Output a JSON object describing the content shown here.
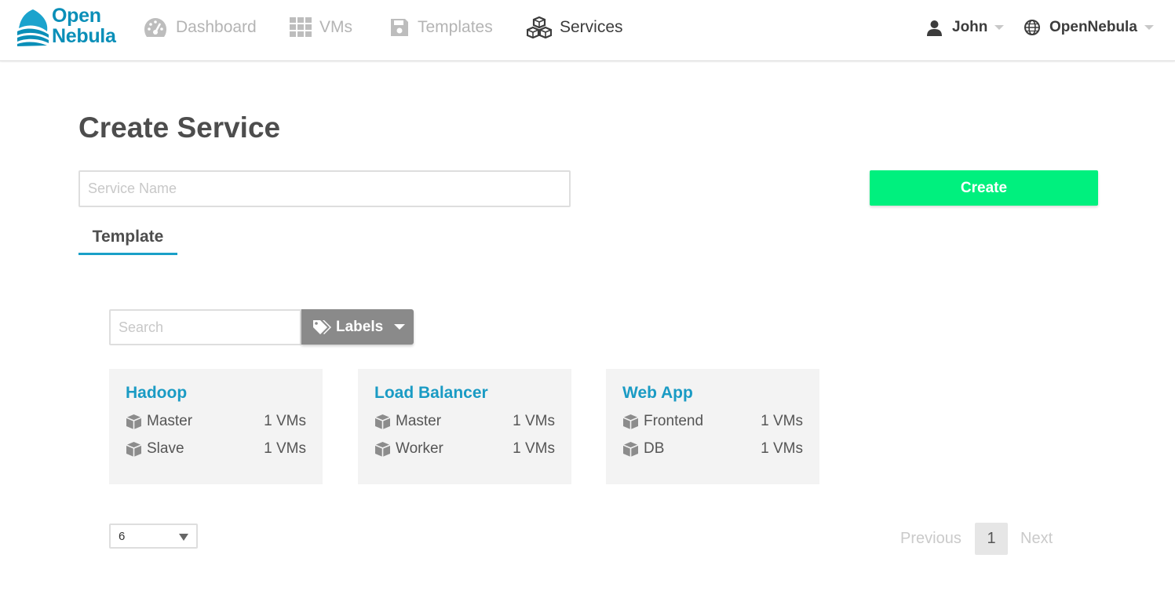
{
  "brand": {
    "line1": "Open",
    "line2": "Nebula",
    "color": "#0a8fb8"
  },
  "nav": [
    {
      "label": "Dashboard",
      "icon": "dashboard-icon",
      "active": false
    },
    {
      "label": "VMs",
      "icon": "grid-icon",
      "active": false
    },
    {
      "label": "Templates",
      "icon": "floppy-disk-icon",
      "active": false
    },
    {
      "label": "Services",
      "icon": "cubes-icon",
      "active": true
    }
  ],
  "user_menu": {
    "label": "John",
    "icon": "user-icon"
  },
  "zone_menu": {
    "label": "OpenNebula",
    "icon": "globe-icon"
  },
  "page": {
    "title": "Create Service",
    "service_name_placeholder": "Service Name",
    "service_name_value": "",
    "create_label": "Create",
    "create_color": "#00f07e",
    "tab_label": "Template"
  },
  "filter": {
    "search_placeholder": "Search",
    "labels_label": "Labels",
    "labels_icon": "tags-icon"
  },
  "templates": [
    {
      "name": "Hadoop",
      "roles": [
        {
          "name": "Master",
          "count": "1 VMs"
        },
        {
          "name": "Slave",
          "count": "1 VMs"
        }
      ]
    },
    {
      "name": "Load Balancer",
      "roles": [
        {
          "name": "Master",
          "count": "1 VMs"
        },
        {
          "name": "Worker",
          "count": "1 VMs"
        }
      ]
    },
    {
      "name": "Web App",
      "roles": [
        {
          "name": "Frontend",
          "count": "1 VMs"
        },
        {
          "name": "DB",
          "count": "1 VMs"
        }
      ]
    }
  ],
  "pagination": {
    "page_size": "6",
    "previous": "Previous",
    "current": "1",
    "next": "Next"
  },
  "colors": {
    "accent": "#1aa0c8",
    "card_bg": "#f3f3f3",
    "labels_button": "#8a8a8a"
  }
}
